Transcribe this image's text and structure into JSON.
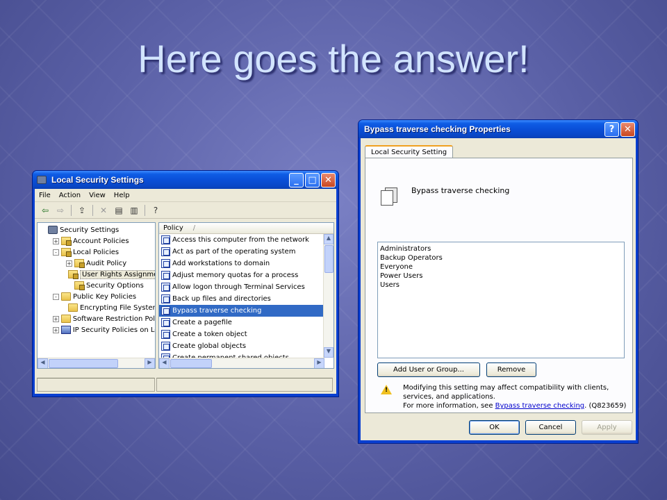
{
  "slide": {
    "title": "Here goes the answer!"
  },
  "lss": {
    "title": "Local Security Settings",
    "menu": [
      "File",
      "Action",
      "View",
      "Help"
    ],
    "toolbar_icons": [
      "back-icon",
      "forward-icon",
      "up-folder-icon",
      "delete-icon",
      "properties-icon",
      "export-list-icon",
      "help-icon"
    ],
    "tree": [
      {
        "label": "Security Settings",
        "indent": 0,
        "expander": "",
        "icon": "shield"
      },
      {
        "label": "Account Policies",
        "indent": 1,
        "expander": "+",
        "icon": "lockfolder"
      },
      {
        "label": "Local Policies",
        "indent": 1,
        "expander": "-",
        "icon": "lockfolder"
      },
      {
        "label": "Audit Policy",
        "indent": 2,
        "expander": "+",
        "icon": "lockfolder"
      },
      {
        "label": "User Rights Assignmen",
        "indent": 2,
        "expander": "",
        "icon": "lockfolder",
        "selected": true
      },
      {
        "label": "Security Options",
        "indent": 2,
        "expander": "",
        "icon": "lockfolder"
      },
      {
        "label": "Public Key Policies",
        "indent": 1,
        "expander": "-",
        "icon": "folder"
      },
      {
        "label": "Encrypting File System",
        "indent": 2,
        "expander": "",
        "icon": "folder"
      },
      {
        "label": "Software Restriction Policie",
        "indent": 1,
        "expander": "+",
        "icon": "folder"
      },
      {
        "label": "IP Security Policies on Loca",
        "indent": 1,
        "expander": "+",
        "icon": "net"
      }
    ],
    "list_header": "Policy",
    "policies": [
      {
        "label": "Access this computer from the network"
      },
      {
        "label": "Act as part of the operating system"
      },
      {
        "label": "Add workstations to domain"
      },
      {
        "label": "Adjust memory quotas for a process"
      },
      {
        "label": "Allow logon through Terminal Services"
      },
      {
        "label": "Back up files and directories"
      },
      {
        "label": "Bypass traverse checking",
        "selected": true
      },
      {
        "label": "Create a pagefile"
      },
      {
        "label": "Create a token object"
      },
      {
        "label": "Create global objects"
      },
      {
        "label": "Create permanent shared objects"
      }
    ]
  },
  "props": {
    "title": "Bypass traverse checking Properties",
    "help_btn": "?",
    "close_btn": "✕",
    "tab": "Local Security Setting",
    "policy_name": "Bypass traverse checking",
    "users": [
      "Administrators",
      "Backup Operators",
      "Everyone",
      "Power Users",
      "Users"
    ],
    "add_btn": "Add User or Group...",
    "remove_btn": "Remove",
    "warning_line1": "Modifying this setting may affect compatibility with clients, services, and applications.",
    "warning_prefix": "For more information, see ",
    "warning_link": "Bypass traverse checking",
    "warning_suffix": ". (Q823659)",
    "ok": "OK",
    "cancel": "Cancel",
    "apply": "Apply"
  }
}
